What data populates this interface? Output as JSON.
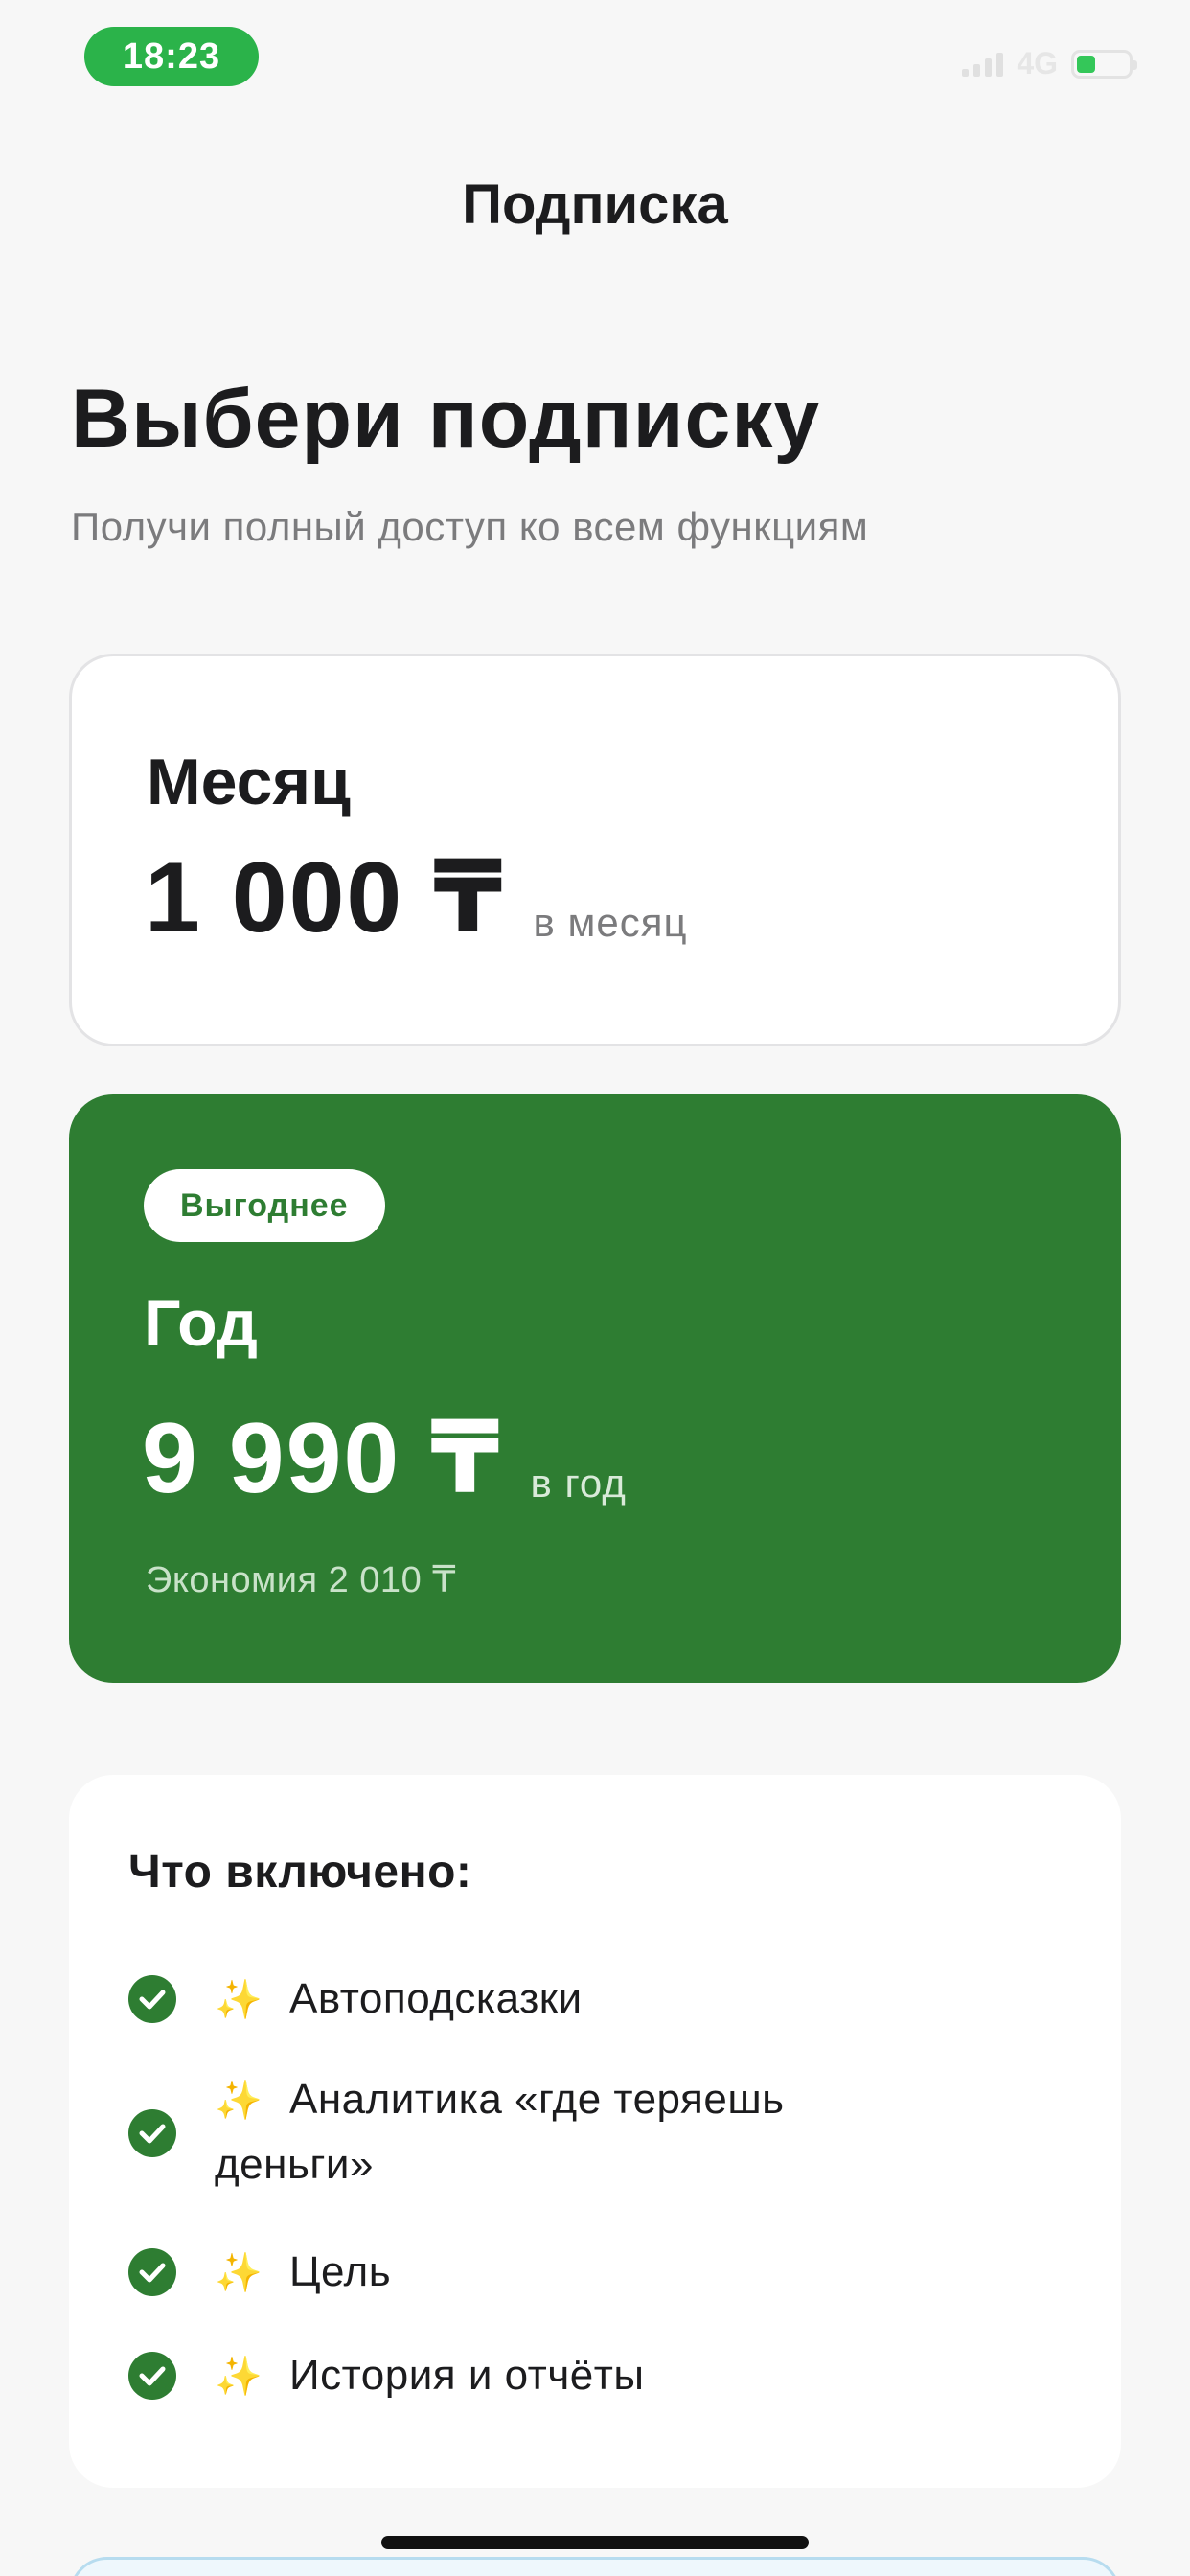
{
  "status_bar": {
    "time": "18:23",
    "network": "4G",
    "battery_color": "#34c759",
    "time_pill_color": "#2bb34a"
  },
  "header": {
    "title": "Подписка"
  },
  "intro": {
    "title": "Выбери подписку",
    "subtitle": "Получи полный доступ ко всем функциям"
  },
  "plans": {
    "monthly": {
      "name": "Месяц",
      "price": "1 000 ₸",
      "period": "в месяц"
    },
    "yearly": {
      "badge": "Выгоднее",
      "name": "Год",
      "price": "9 990 ₸",
      "period": "в год",
      "savings": "Экономия 2 010 ₸",
      "accent_color": "#2e7d32"
    }
  },
  "features": {
    "title": "Что включено:",
    "items": [
      {
        "icon": "check-circle-icon",
        "emoji": "✨",
        "text": "Автоподсказки"
      },
      {
        "icon": "check-circle-icon",
        "emoji": "✨",
        "text_line1": "Аналитика «где теряешь",
        "text_line2": "деньги»"
      },
      {
        "icon": "check-circle-icon",
        "emoji": "✨",
        "text": "Цель"
      },
      {
        "icon": "check-circle-icon",
        "emoji": "✨",
        "text": "История и отчёты"
      }
    ]
  }
}
